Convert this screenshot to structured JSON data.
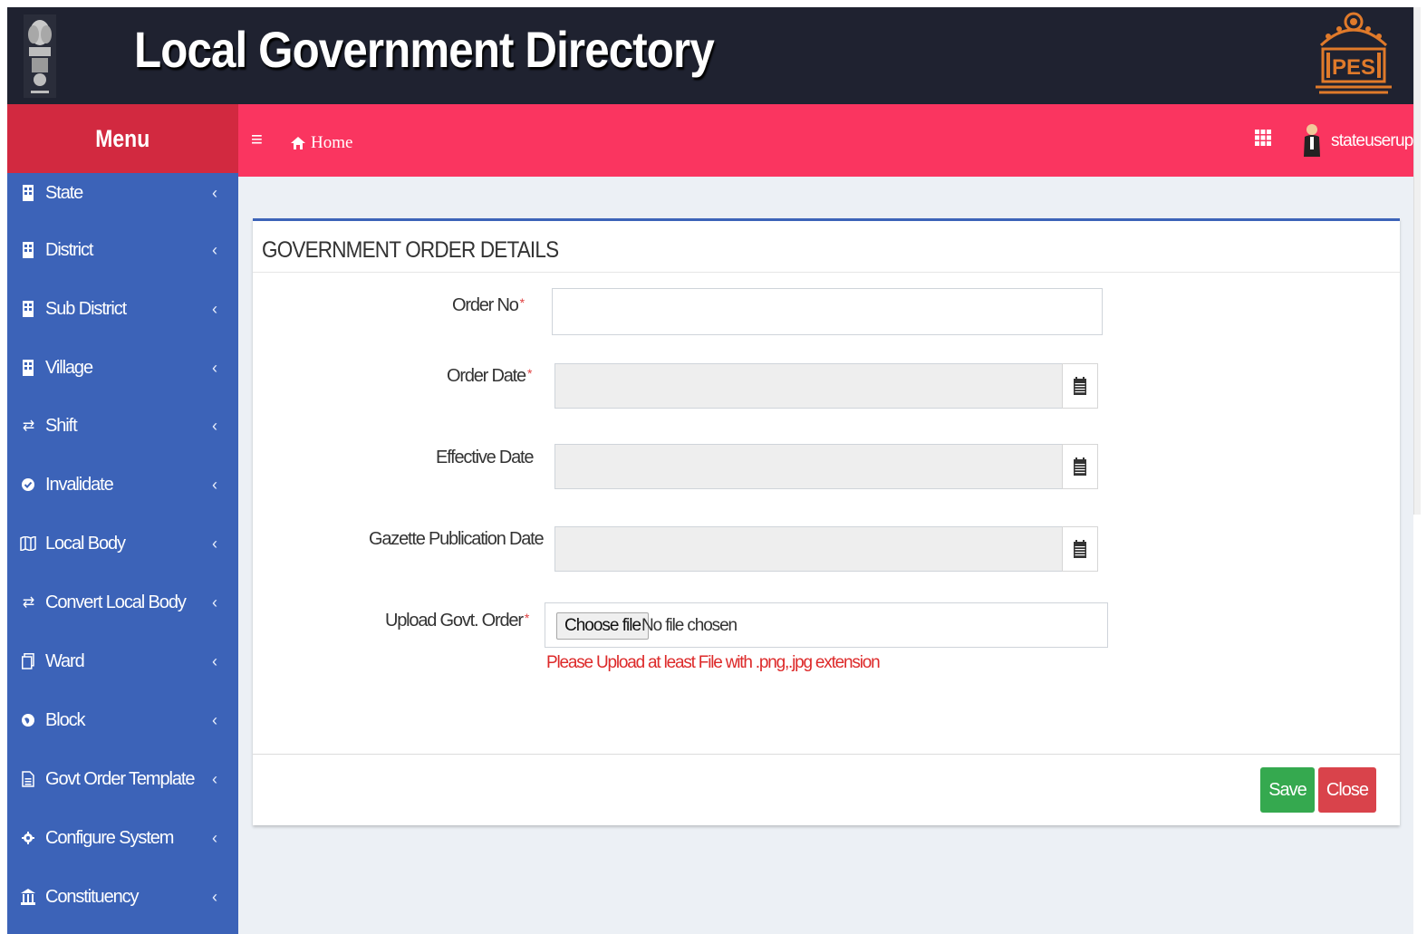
{
  "header": {
    "app_title": "Local Government Directory",
    "logo_text": "PES"
  },
  "menu": {
    "title": "Menu"
  },
  "navbar": {
    "home_label": "Home",
    "username": "stateuserup"
  },
  "sidebar": {
    "items": [
      {
        "label": "State",
        "icon": "building-icon"
      },
      {
        "label": "District",
        "icon": "building-icon"
      },
      {
        "label": "Sub District",
        "icon": "building-icon"
      },
      {
        "label": "Village",
        "icon": "building-icon"
      },
      {
        "label": "Shift",
        "icon": "exchange-icon"
      },
      {
        "label": "Invalidate",
        "icon": "check-circle-icon"
      },
      {
        "label": "Local Body",
        "icon": "map-icon"
      },
      {
        "label": "Convert Local Body",
        "icon": "exchange-icon"
      },
      {
        "label": "Ward",
        "icon": "copy-icon"
      },
      {
        "label": "Block",
        "icon": "globe-icon"
      },
      {
        "label": "Govt Order Template",
        "icon": "file-icon"
      },
      {
        "label": "Configure System",
        "icon": "cog-icon"
      },
      {
        "label": "Constituency",
        "icon": "institution-icon"
      }
    ]
  },
  "form": {
    "title": "GOVERNMENT ORDER DETAILS",
    "order_no_label": "Order No",
    "order_no_value": "",
    "order_date_label": "Order Date",
    "order_date_value": "",
    "effective_date_label": "Effective Date",
    "effective_date_value": "",
    "gazette_date_label": "Gazette Publication Date",
    "gazette_date_value": "",
    "upload_label": "Upload Govt. Order",
    "choose_file_label": "Choose file",
    "no_file_text": "No file chosen",
    "upload_help": "Please Upload at least File with .png,.jpg extension",
    "required_mark": "*",
    "save_label": "Save",
    "close_label": "Close"
  },
  "colors": {
    "topbar": "#1f2230",
    "navbar": "#fa3560",
    "menu_header": "#d22940",
    "sidebar": "#3c63b8",
    "save": "#35a94f",
    "close": "#d9434b",
    "error_text": "#dd2a2a"
  }
}
